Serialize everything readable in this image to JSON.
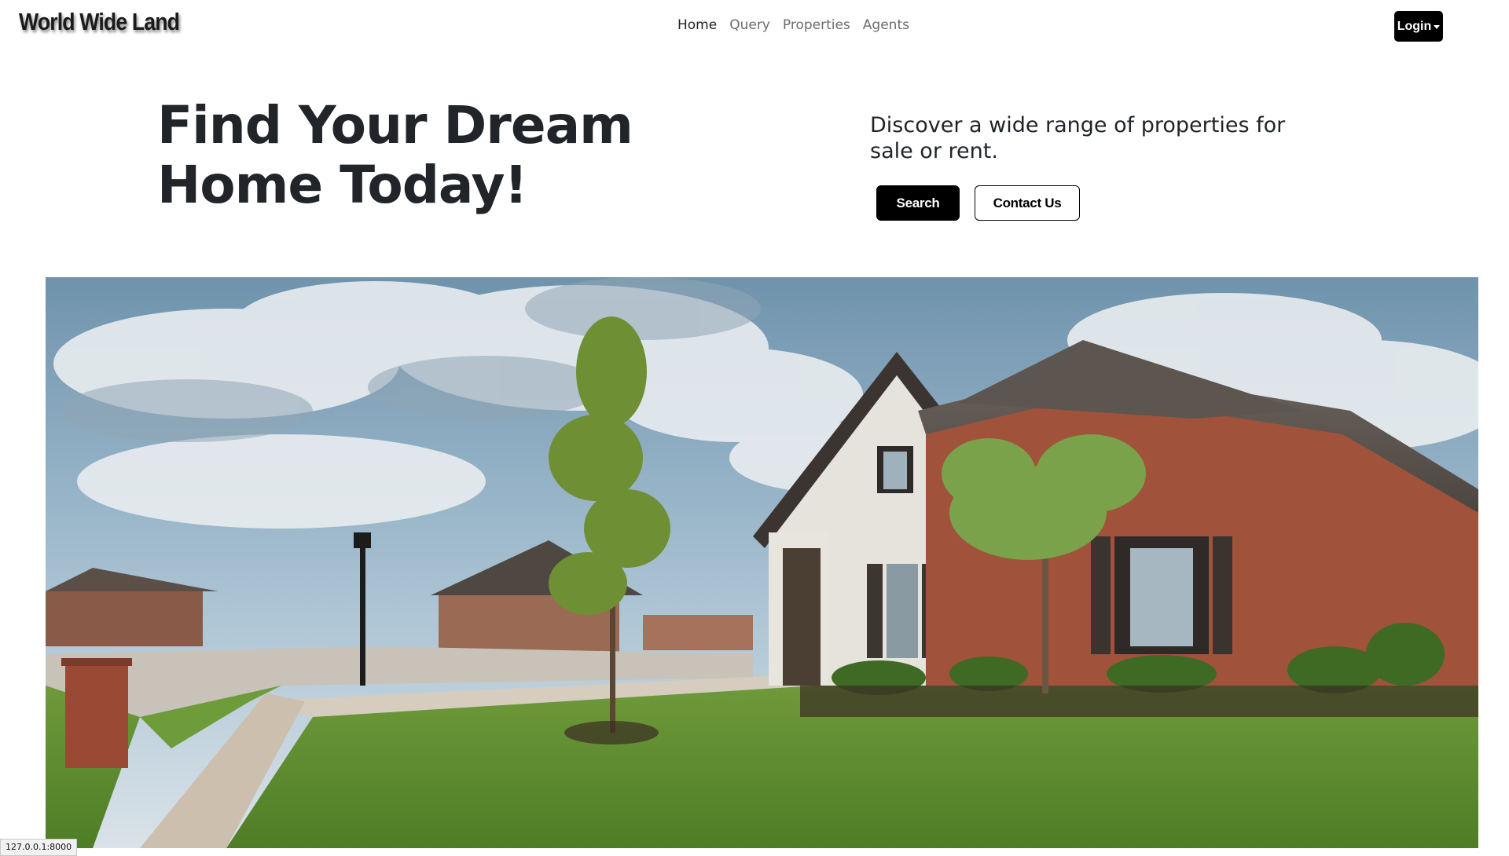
{
  "navbar": {
    "brand": "World Wide Land",
    "links": [
      {
        "label": "Home",
        "active": true
      },
      {
        "label": "Query",
        "active": false
      },
      {
        "label": "Properties",
        "active": false
      },
      {
        "label": "Agents",
        "active": false
      }
    ],
    "login_label": "Login"
  },
  "hero": {
    "title": "Find Your Dream Home Today!",
    "subtitle": "Discover a wide range of properties for sale or rent.",
    "search_label": "Search",
    "contact_label": "Contact Us"
  },
  "status_bar": {
    "url": "127.0.0.1:8000"
  },
  "colors": {
    "primary_button": "#000000",
    "text": "#212529",
    "nav_inactive": "#6c6c6c"
  }
}
